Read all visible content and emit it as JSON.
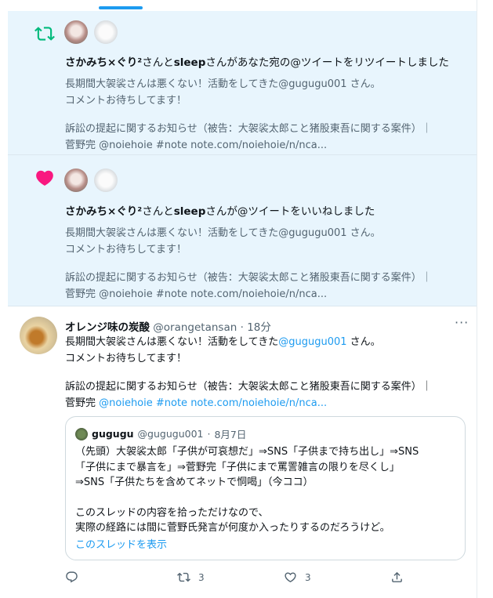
{
  "colors": {
    "accent": "#1d9bf0",
    "retweet": "#00ba7c",
    "like": "#f91880",
    "highlight_bg": "#e8f5fd",
    "muted": "#536471"
  },
  "notifications": [
    {
      "type": "retweet",
      "icon": "retweet-icon",
      "title_user1": "さかみち×ぐり²",
      "title_mid": "さんと",
      "title_user2": "sleep",
      "title_rest": "さんがあなた宛の@ツイートをリツイートしました",
      "text_line1": "長期間大袈裟さんは悪くない！活動をしてきた@gugugu001 さん。",
      "text_line2": "コメントお待ちしてます！",
      "text_line3": "訴訟の提起に関するお知らせ（被告：大袈裟太郎こと猪股東吾に関する案件）｜",
      "text_line4": "菅野完 @noiehoie #note note.com/noiehoie/n/nca..."
    },
    {
      "type": "like",
      "icon": "heart-icon",
      "title_user1": "さかみち×ぐり²",
      "title_mid": "さんと",
      "title_user2": "sleep",
      "title_rest": "さんが@ツイートをいいねしました",
      "text_line1": "長期間大袈裟さんは悪くない！活動をしてきた@gugugu001 さん。",
      "text_line2": "コメントお待ちしてます！",
      "text_line3": "訴訟の提起に関するお知らせ（被告：大袈裟太郎こと猪股東吾に関する案件）｜",
      "text_line4": "菅野完 @noiehoie #note note.com/noiehoie/n/nca..."
    }
  ],
  "tweet": {
    "name": "オレンジ味の炭酸",
    "handle": "@orangetansan",
    "sep": "·",
    "time": "18分",
    "more": "···",
    "line1_pre": "長期間大袈裟さんは悪くない！活動をしてきた",
    "line1_mention": "@gugugu001",
    "line1_post": " さん。",
    "line2": "コメントお待ちしてます！",
    "line3": "訴訟の提起に関するお知らせ（被告：大袈裟太郎こと猪股東吾に関する案件）｜",
    "line4_pre": "菅野完 ",
    "line4_link": "@noiehoie #note note.com/noiehoie/n/nca...",
    "quote": {
      "name": "gugugu",
      "handle": "@gugugu001",
      "sep": "·",
      "date": "8月7日",
      "line1": "（先頭）大袈裟太郎「子供が可哀想だ」⇒SNS「子供まで持ち出し」⇒SNS",
      "line2": "「子供にまで暴言を」⇒菅野完「子供にまで罵詈雑言の限りを尽くし」",
      "line3": "⇒SNS「子供たちを含めてネットで恫喝」（今ココ）",
      "line4": "このスレッドの内容を拾っただけなので、",
      "line5": "実際の経路には間に菅野氏発言が何度か入ったりするのだろうけど。",
      "show_thread": "このスレッドを表示"
    },
    "actions": {
      "reply_count": "",
      "retweet_count": "3",
      "like_count": "3"
    }
  }
}
